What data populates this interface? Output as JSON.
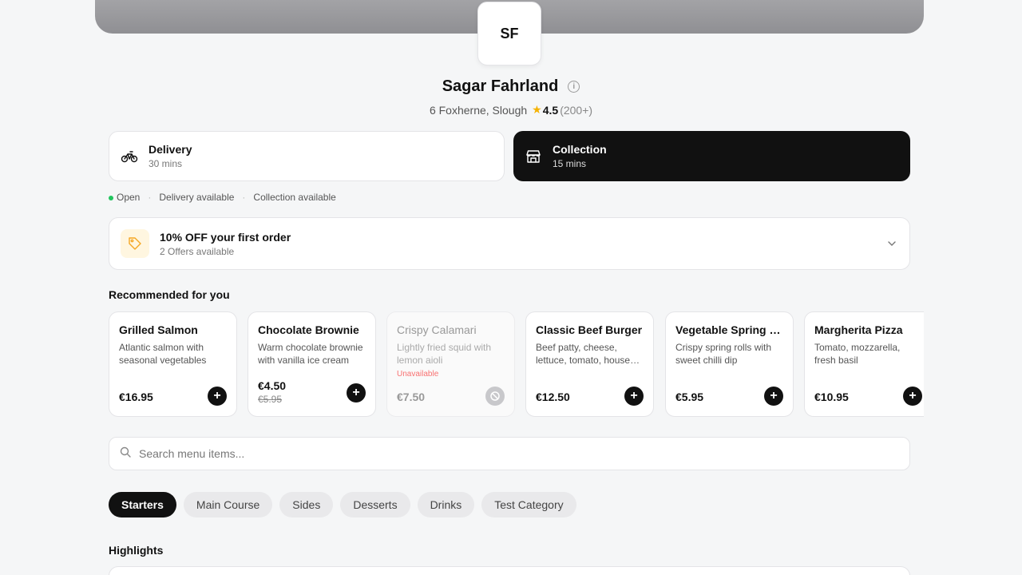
{
  "restaurant": {
    "initials": "SF",
    "name": "Sagar Fahrland",
    "address": "6 Foxherne, Slough",
    "rating": "4.5",
    "rating_count": "(200+)"
  },
  "modes": [
    {
      "label": "Delivery",
      "time": "30 mins",
      "icon": "bicycle-icon",
      "selected": false
    },
    {
      "label": "Collection",
      "time": "15 mins",
      "icon": "storefront-icon",
      "selected": true
    }
  ],
  "status": {
    "open": "Open",
    "delivery": "Delivery available",
    "collection": "Collection available",
    "open_color": "#22c55e"
  },
  "offer": {
    "title": "10% OFF your first order",
    "subtitle": "2 Offers available",
    "icon": "tag-icon"
  },
  "recommended": {
    "title": "Recommended for you",
    "items": [
      {
        "name": "Grilled Salmon",
        "description": "Atlantic salmon with seasonal vegetables",
        "price": "€16.95",
        "available": true
      },
      {
        "name": "Chocolate Brownie",
        "description": "Warm chocolate brownie with vanilla ice cream",
        "price": "€4.50",
        "old_price": "€5.95",
        "available": true
      },
      {
        "name": "Crispy Calamari",
        "description": "Lightly fried squid with lemon aioli",
        "price": "€7.50",
        "available": false,
        "flag": "Unavailable"
      },
      {
        "name": "Classic Beef Burger",
        "description": "Beef patty, cheese, lettuce, tomato, house sauce",
        "price": "€12.50",
        "available": true
      },
      {
        "name": "Vegetable Spring Rolls",
        "description": "Crispy spring rolls with sweet chilli dip",
        "price": "€5.95",
        "available": true
      },
      {
        "name": "Margherita Pizza",
        "description": "Tomato, mozzarella, fresh basil",
        "price": "€10.95",
        "available": true
      }
    ]
  },
  "search": {
    "placeholder": "Search menu items...",
    "value": ""
  },
  "categories": {
    "active": "Starters",
    "items": [
      "Starters",
      "Main Course",
      "Sides",
      "Desserts",
      "Drinks",
      "Test Category"
    ]
  },
  "highlights": {
    "title": "Highlights"
  },
  "colors": {
    "accent": "#111111",
    "unavailable": "#f87171",
    "rating_star": "#f5b200"
  }
}
